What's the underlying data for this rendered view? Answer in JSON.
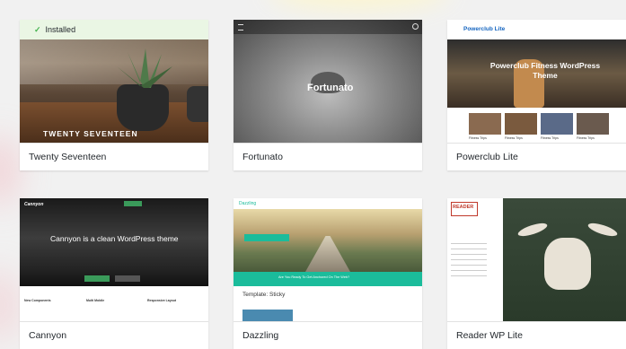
{
  "themes": [
    {
      "name": "Twenty Seventeen",
      "installed": true,
      "installed_label": "Installed",
      "hero": "TWENTY SEVENTEEN"
    },
    {
      "name": "Fortunato",
      "hero": "Fortunato"
    },
    {
      "name": "Powerclub Lite",
      "brand": "Powerclub Lite",
      "hero": "Powerclub Fitness WordPress Theme",
      "tiles": [
        "Fitness Trips",
        "Fitness Trips",
        "Fitness Trips",
        "Fitness Trips"
      ]
    },
    {
      "name": "Cannyon",
      "brand": "Cannyon",
      "hero": "Cannyon is a clean WordPress theme",
      "cols": [
        "New Components",
        "Multi Mobile",
        "Responsive Layout"
      ]
    },
    {
      "name": "Dazzling",
      "brand": "Dazzling",
      "hero": "Template: Sticky",
      "banner": "Are You Ready To Get Anchored On The Web?"
    },
    {
      "name": "Reader WP Lite",
      "brand": "READER"
    }
  ],
  "colors": {
    "accent": "#2ea2cc",
    "installed_bg": "#eaf6e4",
    "check": "#46b450",
    "dazzling_green": "#1bbc9b"
  }
}
